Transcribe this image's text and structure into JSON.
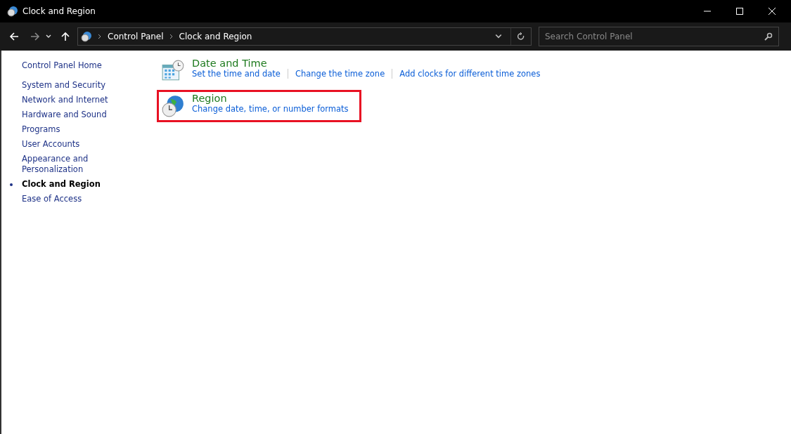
{
  "window": {
    "title": "Clock and Region"
  },
  "address_bar": {
    "breadcrumbs": [
      "Control Panel",
      "Clock and Region"
    ]
  },
  "search": {
    "placeholder": "Search Control Panel"
  },
  "sidebar": {
    "home": "Control Panel Home",
    "items": [
      {
        "label": "System and Security",
        "selected": false
      },
      {
        "label": "Network and Internet",
        "selected": false
      },
      {
        "label": "Hardware and Sound",
        "selected": false
      },
      {
        "label": "Programs",
        "selected": false
      },
      {
        "label": "User Accounts",
        "selected": false
      },
      {
        "label": "Appearance and Personalization",
        "selected": false
      },
      {
        "label": "Clock and Region",
        "selected": true
      },
      {
        "label": "Ease of Access",
        "selected": false
      }
    ]
  },
  "categories": [
    {
      "kind": "calendar",
      "title": "Date and Time",
      "highlighted": false,
      "links": [
        "Set the time and date",
        "Change the time zone",
        "Add clocks for different time zones"
      ]
    },
    {
      "kind": "globe",
      "title": "Region",
      "highlighted": true,
      "links": [
        "Change date, time, or number formats"
      ]
    }
  ]
}
